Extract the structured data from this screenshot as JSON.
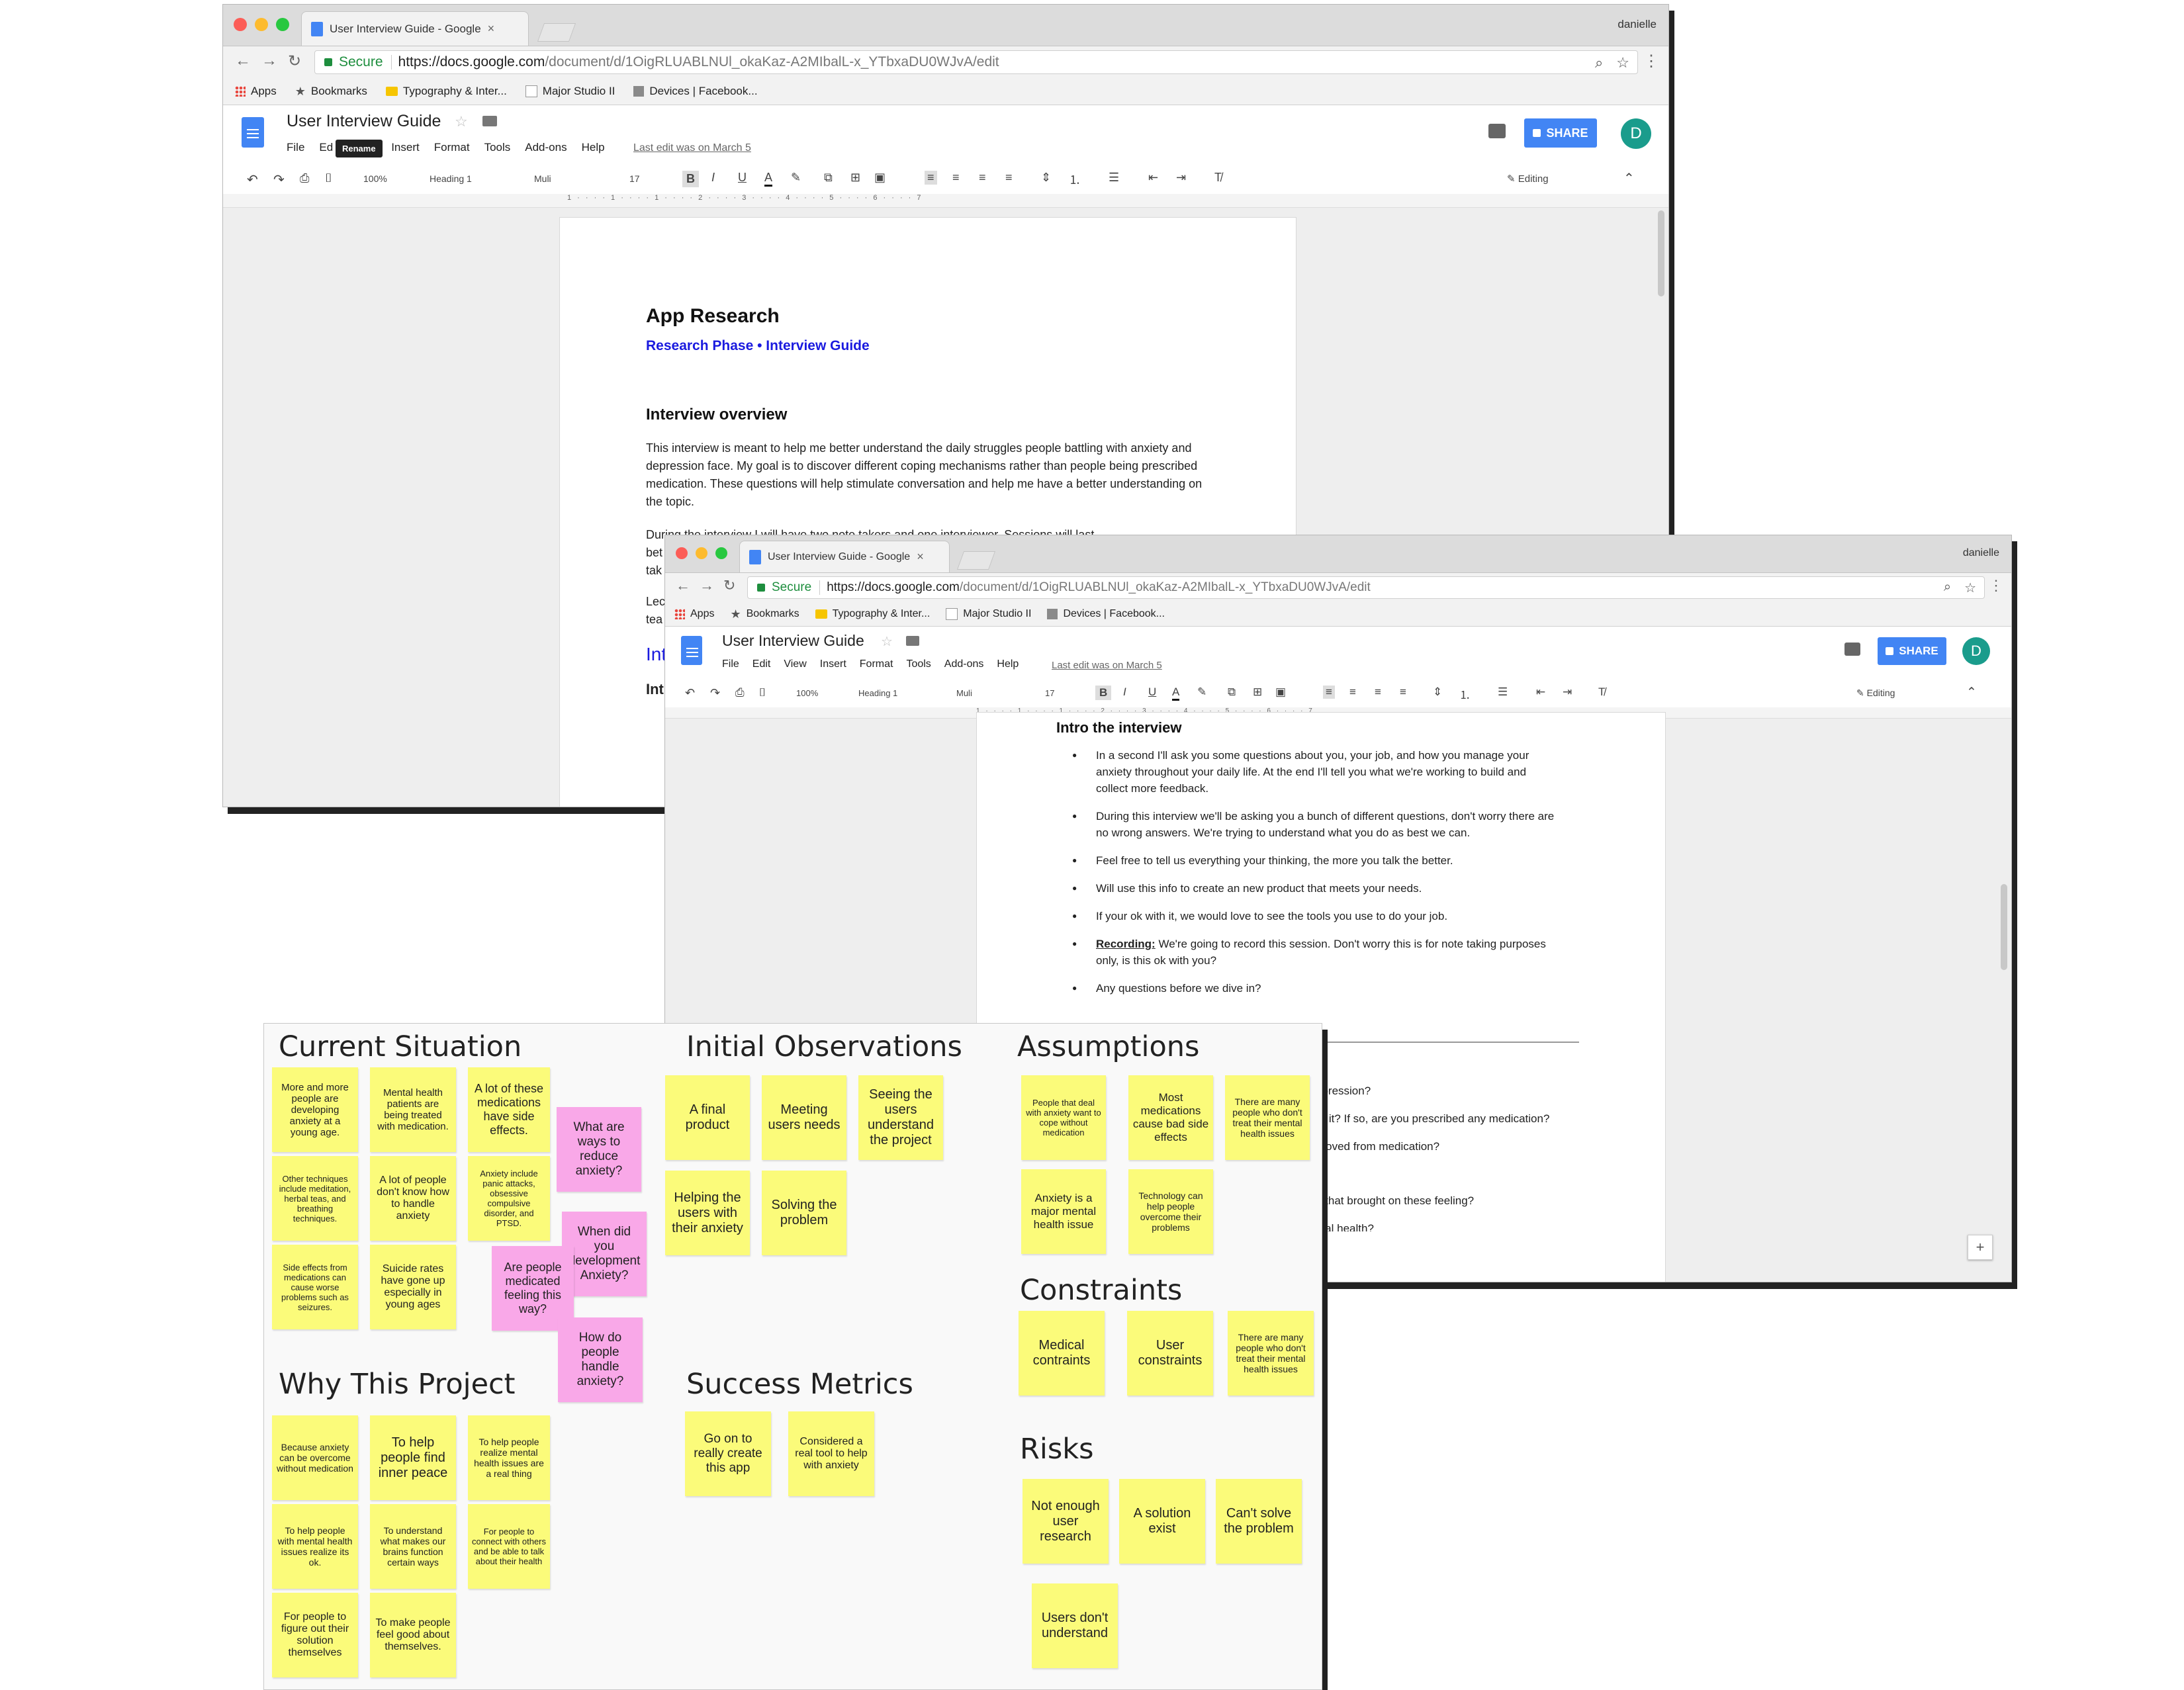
{
  "window1": {
    "tab_title": "User Interview Guide - Google",
    "tab_close": "×",
    "user": "danielle",
    "secure": "Secure",
    "url_host": "https://docs.google.com",
    "url_path": "/document/d/1OigRLUABLNUl_okaKaz-A2MIbalL-x_YTbxaDU0WJvA/edit",
    "bookmarks": [
      "Apps",
      "Bookmarks",
      "Typography & Inter...",
      "Major Studio II",
      "Devices | Facebook..."
    ],
    "doc_title": "User Interview Guide",
    "menus": [
      "File",
      "Ed",
      "",
      "Insert",
      "Format",
      "Tools",
      "Add-ons",
      "Help"
    ],
    "tooltip": "Rename",
    "last_edit": "Last edit was on March 5",
    "share": "SHARE",
    "avatar": "D",
    "toolbar": {
      "zoom": "100%",
      "style": "Heading 1",
      "font": "Muli",
      "size": "17",
      "mode": "Editing"
    },
    "page": {
      "title": "App Research",
      "subtitle": "Research Phase •  Interview Guide",
      "section1": "Interview overview",
      "para1": "This interview is meant to help me better understand the daily struggles people battling with anxiety and depression face. My goal is to discover different coping mechanisms rather than people being prescribed medication. These questions will help stimulate conversation and help me have a better understanding on the topic.",
      "para2": "During the interview I will have two note takers and one interviewer. Sessions will last",
      "frag_bet": "bet",
      "frag_tak": "tak",
      "frag_lec": "Lec",
      "frag_tea": "tea",
      "frag_int_blue": "Int",
      "frag_int": "Int"
    }
  },
  "window2": {
    "tab_title": "User Interview Guide - Google",
    "tab_close": "×",
    "user": "danielle",
    "secure": "Secure",
    "url_host": "https://docs.google.com",
    "url_path": "/document/d/1OigRLUABLNUl_okaKaz-A2MIbalL-x_YTbxaDU0WJvA/edit",
    "bookmarks": [
      "Apps",
      "Bookmarks",
      "Typography & Inter...",
      "Major Studio II",
      "Devices | Facebook..."
    ],
    "doc_title": "User Interview Guide",
    "menus": [
      "File",
      "Edit",
      "View",
      "Insert",
      "Format",
      "Tools",
      "Add-ons",
      "Help"
    ],
    "last_edit": "Last edit was on March 5",
    "share": "SHARE",
    "avatar": "D",
    "toolbar": {
      "zoom": "100%",
      "style": "Heading 1",
      "font": "Muli",
      "size": "17",
      "mode": "Editing"
    },
    "page": {
      "heading": "Intro the interview",
      "bullets": [
        "In a second I'll ask you some questions about you, your job, and how you manage your anxiety throughout your daily life. At the end I'll tell you what we're working to build and collect more feedback.",
        "During this interview we'll be asking you a bunch of different questions, don't worry there are no wrong answers. We're trying to understand what you do as best we can.",
        "Feel free to tell us everything your thinking, the more you talk the better.",
        "Will use this info to create an new product that meets your needs.",
        "If your ok with it, we would love to see the tools you use to do your job.",
        "Any questions before we dive in?"
      ],
      "recording_label": "Recording:",
      "recording_text": " We're going to record this session. Don't worry this is for note taking purposes only, is this ok with you?",
      "q_fragments": [
        "epression?",
        "or it? If so, are you prescribed any medication?",
        "proved from medication?",
        "e that brought on these feeling?",
        "ntal health?"
      ]
    }
  },
  "board": {
    "current_situation": {
      "title": "Current Situation",
      "notes": [
        "More and more people are developing anxiety at a young age.",
        "Mental health patients are being treated with medication.",
        "A lot of these medications have side effects.",
        "Other techniques include meditation, herbal teas, and breathing techniques.",
        "A lot of people don't know how to handle anxiety",
        "Anxiety include panic attacks, obsessive compulsive disorder, and PTSD.",
        "Side effects from medications can cause worse problems such as seizures.",
        "Suicide rates have gone up especially in young ages"
      ],
      "pink_notes": [
        "What are ways to reduce anxiety?",
        "When did you development Anxiety?",
        "Are people medicated feeling this way?",
        "How do people handle anxiety?"
      ]
    },
    "why_this_project": {
      "title": "Why This Project",
      "notes": [
        "Because anxiety can be overcome without medication",
        "To help people find inner peace",
        "To help people realize mental health issues are a real thing",
        "To help people with mental health issues realize its ok.",
        "To understand what makes our brains function certain ways",
        "For people to connect with others and be able to talk about their health",
        "For people to figure out their solution themselves",
        "To make people feel good about themselves."
      ]
    },
    "initial_observations": {
      "title": "Initial Observations",
      "notes": [
        "A final product",
        "Meeting users needs",
        "Seeing the users understand the project",
        "Helping the users with their anxiety",
        "Solving the problem"
      ]
    },
    "success_metrics": {
      "title": "Success Metrics",
      "notes": [
        "Go on to really create this app",
        "Considered a real tool to help with anxiety"
      ]
    },
    "assumptions": {
      "title": "Assumptions",
      "notes": [
        "People that deal with anxiety want to cope without medication",
        "Most medications cause bad side effects",
        "There are many people who don't treat their mental health issues",
        "Anxiety is a major mental health issue",
        "Technology can help people overcome their problems"
      ]
    },
    "constraints": {
      "title": "Constraints",
      "notes": [
        "Medical contraints",
        "User constraints",
        "There are many people who don't treat their mental health issues"
      ]
    },
    "risks": {
      "title": "Risks",
      "notes": [
        "Not enough user research",
        "A solution exist",
        "Can't solve the problem",
        "Users don't understand"
      ]
    }
  }
}
